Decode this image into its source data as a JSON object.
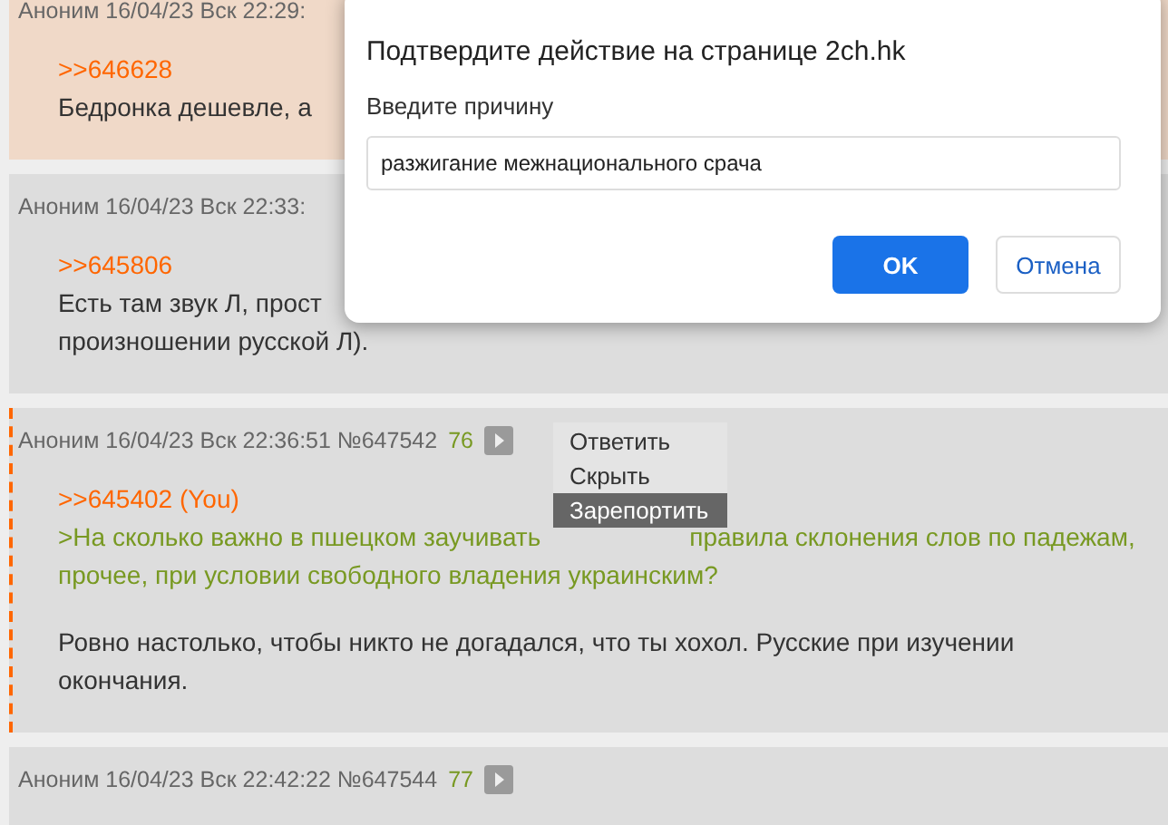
{
  "posts": [
    {
      "header": "Аноним 16/04/23 Вск 22:29:",
      "highlighted": true,
      "marked": false,
      "lines": [
        {
          "kind": "link",
          "text": ">>646628"
        },
        {
          "kind": "text",
          "text": "Бедронка дешевле, а"
        }
      ]
    },
    {
      "header": "Аноним 16/04/23 Вск 22:33:",
      "highlighted": false,
      "marked": false,
      "lines": [
        {
          "kind": "link",
          "text": ">>645806"
        },
        {
          "kind": "text",
          "text": "Есть там звук Л, прост"
        },
        {
          "kind": "text",
          "text": "произношении русской Л)."
        }
      ]
    },
    {
      "header": "Аноним 16/04/23 Вск 22:36:51 №647542",
      "count": "76",
      "highlighted": false,
      "marked": true,
      "lines": [
        {
          "kind": "link",
          "text": ">>645402 (You)"
        },
        {
          "kind": "quote",
          "text": ">На сколько важно в пшецком заучивать",
          "continuation": "правила склонения слов по падежам,"
        },
        {
          "kind": "quote",
          "text": "прочее, при условии свободного владения украинским?"
        },
        {
          "kind": "blank"
        },
        {
          "kind": "text",
          "text": "Ровно настолько, чтобы никто не догадался, что ты хохол. Русские при изучении"
        },
        {
          "kind": "text",
          "text": "окончания."
        }
      ]
    },
    {
      "header": "Аноним 16/04/23 Вск 22:42:22 №647544",
      "count": "77",
      "highlighted": false,
      "marked": false
    }
  ],
  "menu": {
    "items": [
      {
        "label": "Ответить",
        "selected": false
      },
      {
        "label": "Скрыть",
        "selected": false
      },
      {
        "label": "Зарепортить",
        "selected": true
      }
    ]
  },
  "dialog": {
    "title": "Подтвердите действие на странице 2ch.hk",
    "prompt": "Введите причину",
    "value": "разжигание межнационального срача",
    "buttons": [
      {
        "label": "OK",
        "kind": "primary"
      },
      {
        "label": "Отмена",
        "kind": "secondary"
      }
    ]
  }
}
